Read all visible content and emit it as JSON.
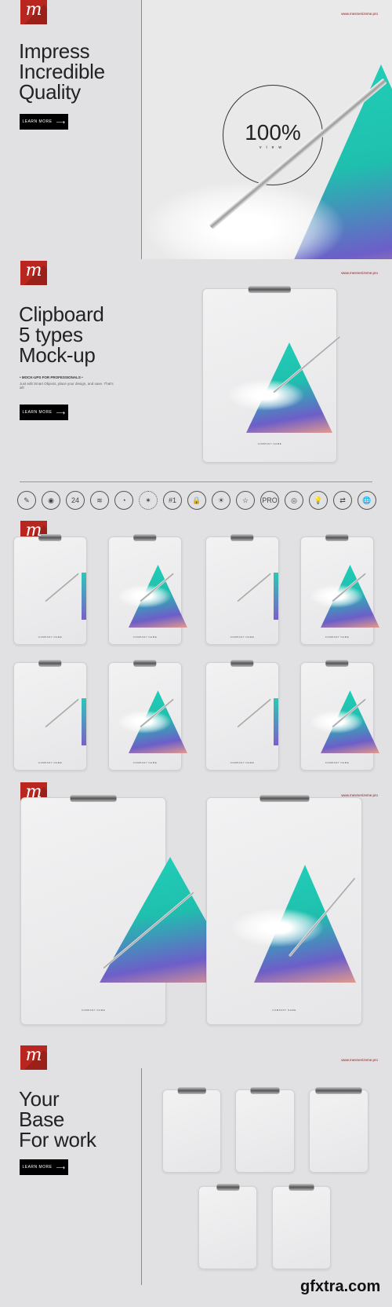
{
  "brand": {
    "logo_letter": "m",
    "url": "www.mesmerizeme.pro",
    "accent": "#b8261f"
  },
  "hero": {
    "title_lines": [
      "Impress",
      "Incredible",
      "Quality"
    ],
    "button": "LEARN MORE",
    "badge_value": "100%",
    "badge_label": "view"
  },
  "section2": {
    "title_lines": [
      "Clipboard",
      "5 types",
      "Mock-up"
    ],
    "subtitle": "• MOCK-UPS FOR PROFESSIONALS •",
    "description": "Just edit Smart Objects, place your design, and save. That's all!",
    "button": "LEARN MORE",
    "company": "COMPANY NAME"
  },
  "features": {
    "icons": [
      "brush-icon",
      "eye-icon",
      "24h-support-icon",
      "layers-icon",
      "timer-icon",
      "eu-stars-icon",
      "number-one-icon",
      "lock-icon",
      "sun-icon",
      "star-icon",
      "pro-icon",
      "lifebuoy-icon",
      "lightbulb-icon",
      "arrows-icon",
      "globe-icon"
    ],
    "icon_glyphs": [
      "✎",
      "◉",
      "24",
      "≋",
      "◔",
      "✶",
      "#1",
      "🔒",
      "☀",
      "☆",
      "PRO",
      "◎",
      "💡",
      "⇄",
      "🌐"
    ]
  },
  "grid": {
    "company": "COMPANY NAME"
  },
  "section5": {
    "title_lines": [
      "Your",
      "Base",
      "For work"
    ],
    "button": "LEARN MORE"
  },
  "watermark": "gfxtra.com"
}
